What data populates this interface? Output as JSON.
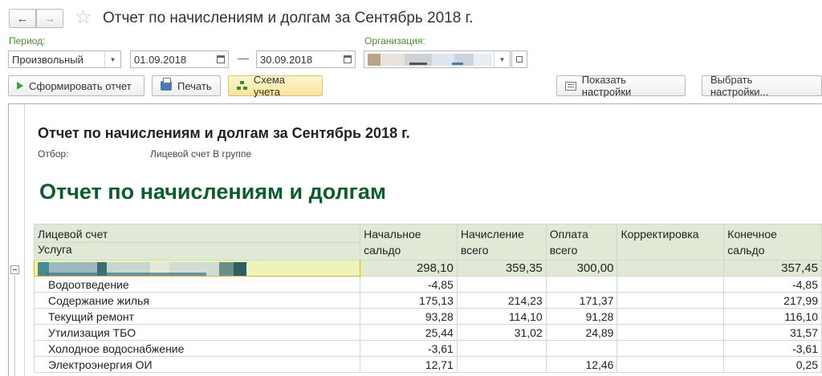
{
  "window": {
    "title": "Отчет по начислениям и долгам за Сентябрь 2018 г.",
    "back_icon": "←",
    "forward_icon": "→",
    "favorite_icon": "☆"
  },
  "filters": {
    "period_label": "Период:",
    "period_value": "Произвольный",
    "date_from": "01.09.2018",
    "date_to": "30.09.2018",
    "date_separator": "—",
    "org_label": "Организация:"
  },
  "toolbar": {
    "generate_label": "Сформировать отчет",
    "print_label": "Печать",
    "scheme_label": "Схема учета",
    "show_settings_label": "Показать настройки",
    "choose_settings_label": "Выбрать настройки..."
  },
  "report": {
    "title": "Отчет по начислениям и долгам за Сентябрь 2018 г.",
    "filter_label": "Отбор:",
    "filter_value": "Лицевой счет В группе",
    "big_title": "Отчет по начислениям и долгам",
    "columns": {
      "account": "Лицевой счет",
      "service": "Услуга",
      "opening_1": "Начальное",
      "opening_2": "сальдо",
      "accrual_1": "Начисление",
      "accrual_2": "всего",
      "payment_1": "Оплата",
      "payment_2": "всего",
      "correction": "Корректировка",
      "closing_1": "Конечное",
      "closing_2": "сальдо"
    },
    "group_row": {
      "opening": "298,10",
      "accrual": "359,35",
      "payment": "300,00",
      "correction": "",
      "closing": "357,45"
    },
    "rows": [
      {
        "service": "Водоотведение",
        "opening": "-4,85",
        "accrual": "",
        "payment": "",
        "correction": "",
        "closing": "-4,85"
      },
      {
        "service": "Содержание жилья",
        "opening": "175,13",
        "accrual": "214,23",
        "payment": "171,37",
        "correction": "",
        "closing": "217,99"
      },
      {
        "service": "Текущий ремонт",
        "opening": "93,28",
        "accrual": "114,10",
        "payment": "91,28",
        "correction": "",
        "closing": "116,10"
      },
      {
        "service": "Утилизация ТБО",
        "opening": "25,44",
        "accrual": "31,02",
        "payment": "24,89",
        "correction": "",
        "closing": "31,57"
      },
      {
        "service": "Холодное водоснабжение",
        "opening": "-3,61",
        "accrual": "",
        "payment": "",
        "correction": "",
        "closing": "-3,61"
      },
      {
        "service": "Электроэнергия ОИ",
        "opening": "12,71",
        "accrual": "",
        "payment": "12,46",
        "correction": "",
        "closing": "0,25"
      }
    ]
  },
  "colors": {
    "accent_green": "#0d5c2e",
    "label_green": "#4b8b3b",
    "header_bg": "#dfe9d6",
    "selected_cell_bg": "#eef3b8"
  }
}
